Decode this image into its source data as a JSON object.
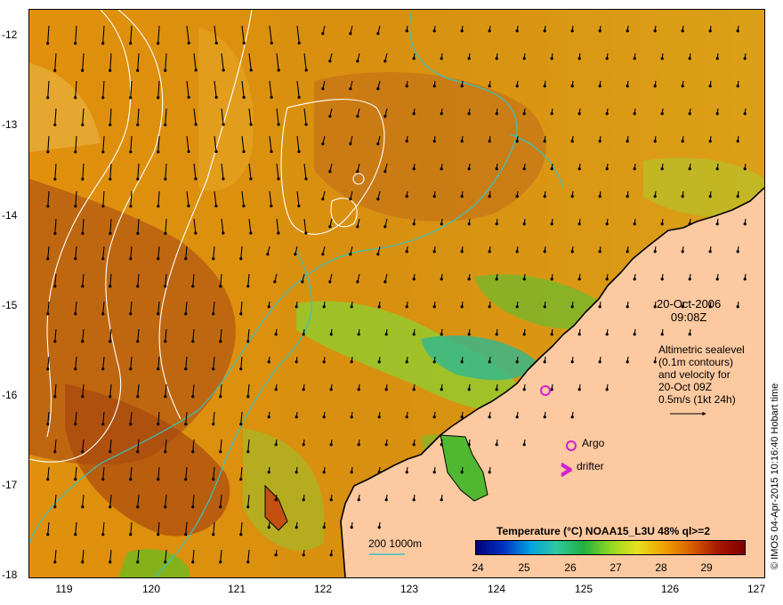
{
  "map": {
    "lon_range": [
      118.6,
      127.0
    ],
    "lat_range": [
      -18.0,
      -11.8
    ],
    "colors": {
      "land": "#fdc9a0",
      "coast": "#000000",
      "isobath": "#36c3c0",
      "contour": "#ffffff",
      "vector": "#000000",
      "argo": "#d020d0",
      "drifter": "#d020d0"
    }
  },
  "axes": {
    "lat_ticks": [
      "-12",
      "-13",
      "-14",
      "-15",
      "-16",
      "-17",
      "-18"
    ],
    "lon_ticks": [
      "119",
      "120",
      "121",
      "122",
      "123",
      "124",
      "125",
      "126",
      "127"
    ]
  },
  "annotation": {
    "date": "20-Oct-2006",
    "time": "09:08Z",
    "line1": "Altimetric sealevel",
    "line2": "(0.1m contours)",
    "line3": "and velocity for",
    "line4": "20-Oct 09Z",
    "line5": "0.5m/s (1kt 24h)"
  },
  "legend": {
    "argo": "Argo",
    "drifter": "drifter",
    "isobath": "200  1000m"
  },
  "colorbar": {
    "title": "Temperature (°C) NOAA15_L3U 48% ql>=2",
    "ticks": [
      "24",
      "25",
      "26",
      "27",
      "28",
      "29"
    ],
    "stops": [
      "#00007a",
      "#0030c0",
      "#00a0e0",
      "#30c8a0",
      "#20b040",
      "#90d820",
      "#e8e020",
      "#f0a000",
      "#d86000",
      "#a81800",
      "#800000"
    ]
  },
  "credit": "© IMOS 04-Apr-2015 10:16:40 Hobart time"
}
